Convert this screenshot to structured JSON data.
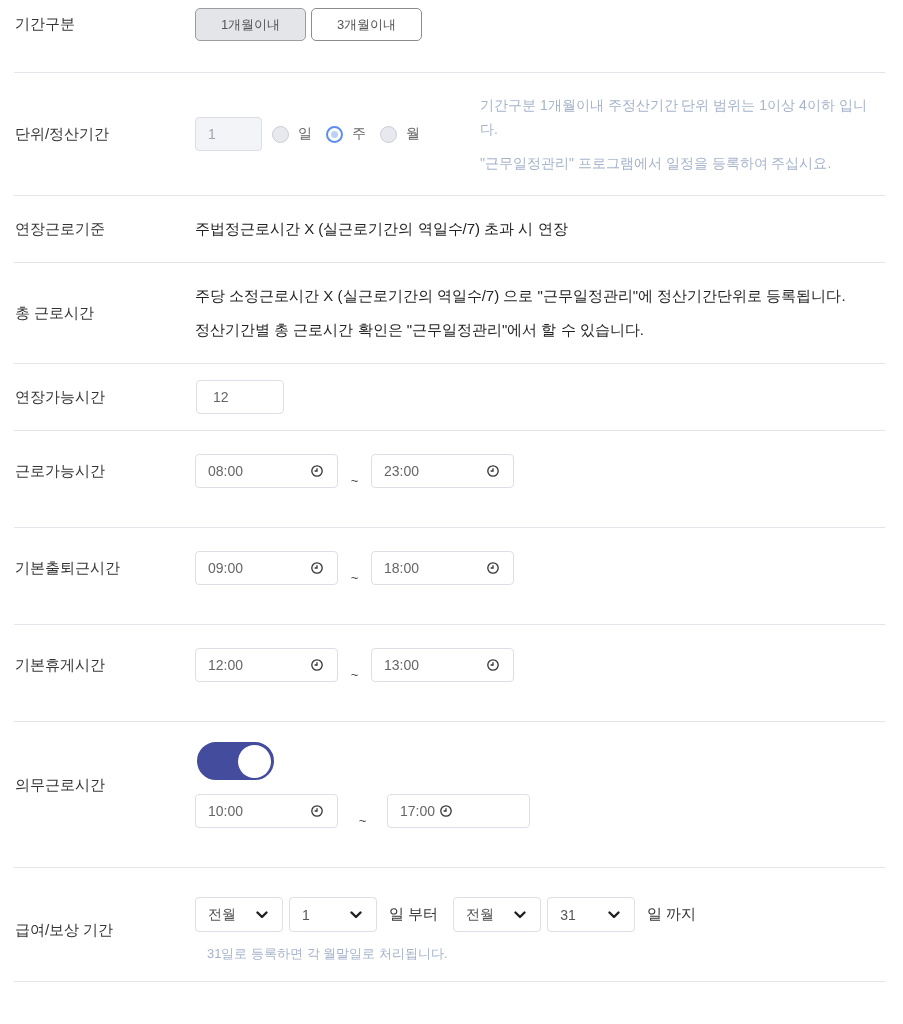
{
  "rows": [
    {
      "kind": "segmented",
      "label": "기간구분",
      "options": [
        {
          "label": "1개월이내",
          "selected": true
        },
        {
          "label": "3개월이내",
          "selected": false
        }
      ]
    },
    {
      "kind": "unit",
      "label": "단위/정산기간",
      "value": "1",
      "disabled": true,
      "units": [
        {
          "label": "일",
          "selected": false
        },
        {
          "label": "주",
          "selected": true
        },
        {
          "label": "월",
          "selected": false
        }
      ],
      "notes": [
        "기간구분 1개월이내 주정산기간 단위 범위는 1이상 4이하 입니다.",
        "\"근무일정관리\" 프로그램에서 일정을 등록하여 주십시요."
      ]
    },
    {
      "kind": "text",
      "label": "연장근로기준",
      "lines": [
        "주법정근로시간 X (실근로기간의 역일수/7) 초과 시 연장"
      ]
    },
    {
      "kind": "text",
      "label": "총 근로시간",
      "lines": [
        "주당 소정근로시간 X (실근로기간의 역일수/7) 으로 \"근무일정관리\"에 정산기간단위로 등록됩니다.",
        "정산기간별 총 근로시간 확인은 \"근무일정관리\"에서 할 수 있습니다."
      ]
    },
    {
      "kind": "input",
      "label": "연장가능시간",
      "value": "12"
    },
    {
      "kind": "time-range",
      "label": "근로가능시간",
      "from": "08:00",
      "separator": "~",
      "to": "23:00"
    },
    {
      "kind": "time-range",
      "label": "기본출퇴근시간",
      "from": "09:00",
      "separator": "~",
      "to": "18:00"
    },
    {
      "kind": "time-range",
      "label": "기본휴게시간",
      "from": "12:00",
      "separator": "~",
      "to": "13:00"
    },
    {
      "kind": "toggle-time-range",
      "label": "의무근로시간",
      "on": true,
      "from": "10:00",
      "separator": "~",
      "to": "17:00"
    },
    {
      "kind": "pay-period",
      "label": "급여/보상 기간",
      "start_month": "전월",
      "start_day": "1",
      "start_suffix": "일 부터",
      "end_month": "전월",
      "end_day": "31",
      "end_suffix": "일 까지",
      "note": "31일로 등록하면 각 월말일로 처리됩니다."
    }
  ]
}
